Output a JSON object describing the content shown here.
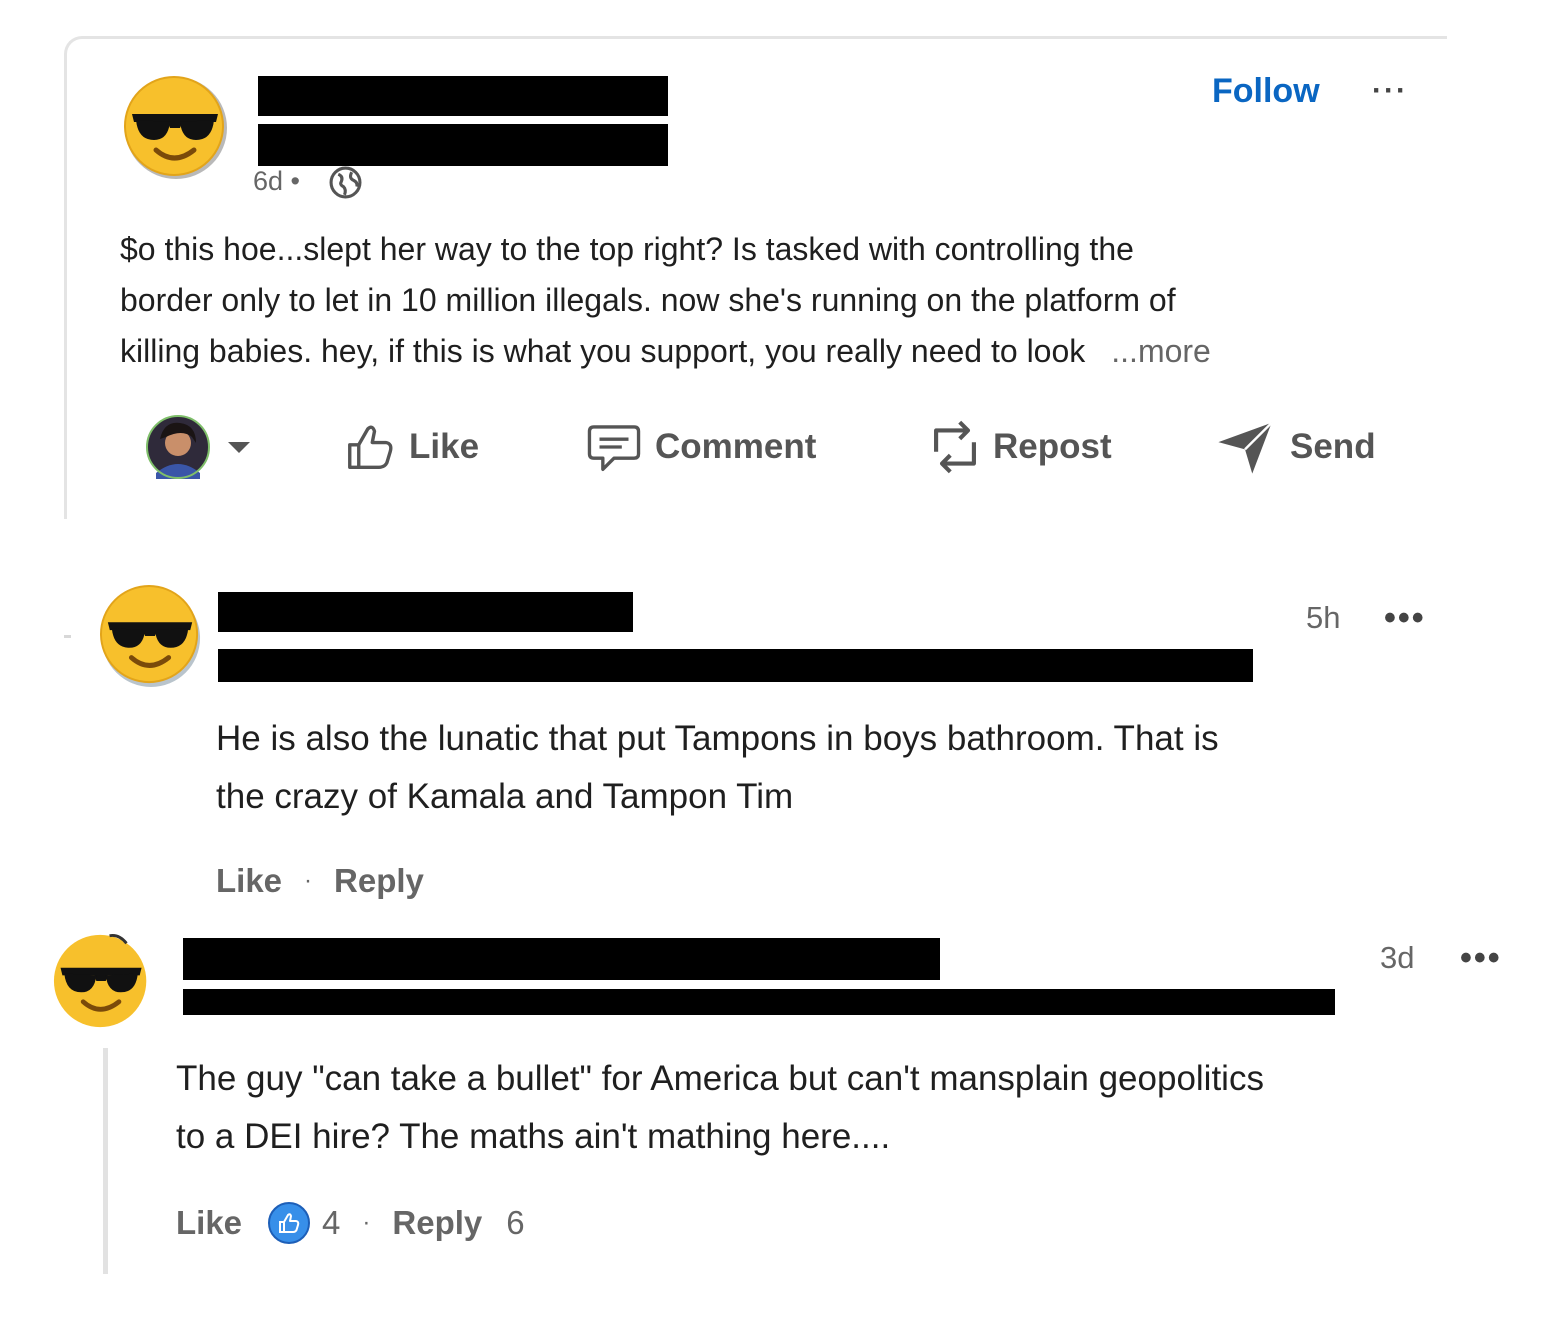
{
  "post": {
    "timestamp": "6d •",
    "follow_label": "Follow",
    "more_options": "···",
    "body_lines": [
      "$o this hoe...slept her way to the top right? Is tasked with controlling the",
      "border only to let in 10 million illegals. now she's running on the platform of",
      "killing babies. hey, if this is what you support, you really need to look"
    ],
    "more_label": "...more",
    "actions": {
      "like": "Like",
      "comment": "Comment",
      "repost": "Repost",
      "send": "Send"
    }
  },
  "comments": [
    {
      "time": "5h",
      "more_options": "•••",
      "lines": [
        "He is also the lunatic that put Tampons in boys bathroom. That is",
        "the crazy of Kamala and Tampon Tim"
      ],
      "like_label": "Like",
      "reply_label": "Reply"
    },
    {
      "time": "3d",
      "more_options": "•••",
      "lines": [
        "The guy \"can take a bullet\" for America but can't mansplain geopolitics",
        "to a DEI hire? The maths ain't mathing here...."
      ],
      "like_label": "Like",
      "reaction_count": "4",
      "reply_label": "Reply",
      "reply_count": "6"
    }
  ],
  "colors": {
    "link_blue": "#0a66c2",
    "muted": "#666666",
    "emoji_yellow": "#f7c02c",
    "redaction": "#000000"
  },
  "icons": [
    "cool-emoji-icon",
    "globe-icon",
    "thumbs-up-icon",
    "comment-icon",
    "repost-icon",
    "send-icon",
    "caret-down-icon",
    "like-reaction-icon"
  ]
}
